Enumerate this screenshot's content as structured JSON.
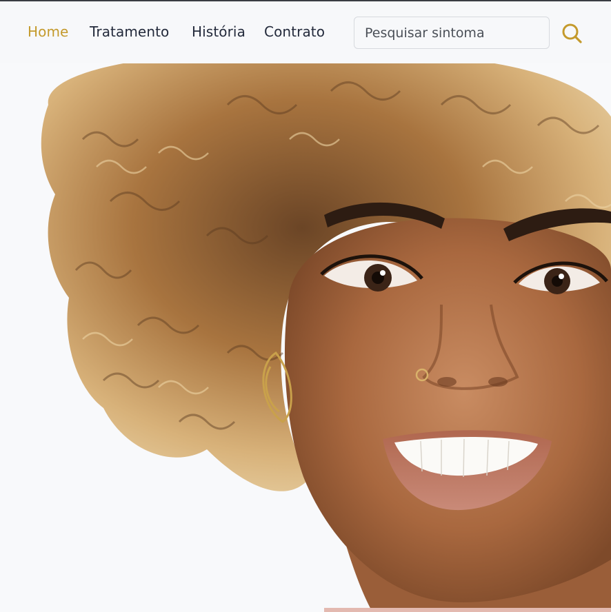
{
  "nav": {
    "links": [
      {
        "label": "Home",
        "active": true
      },
      {
        "label": "Tratamento",
        "active": false
      },
      {
        "label": "História",
        "active": false
      },
      {
        "label": "Contrato",
        "active": false
      }
    ]
  },
  "search": {
    "placeholder": "Pesquisar sintoma",
    "icon": "search-icon"
  },
  "colors": {
    "accent": "#c49a2c",
    "nav_text": "#232a3b",
    "background": "#f7f8fa"
  },
  "hero": {
    "subject": "smiling woman with curly blonde hair portrait"
  }
}
